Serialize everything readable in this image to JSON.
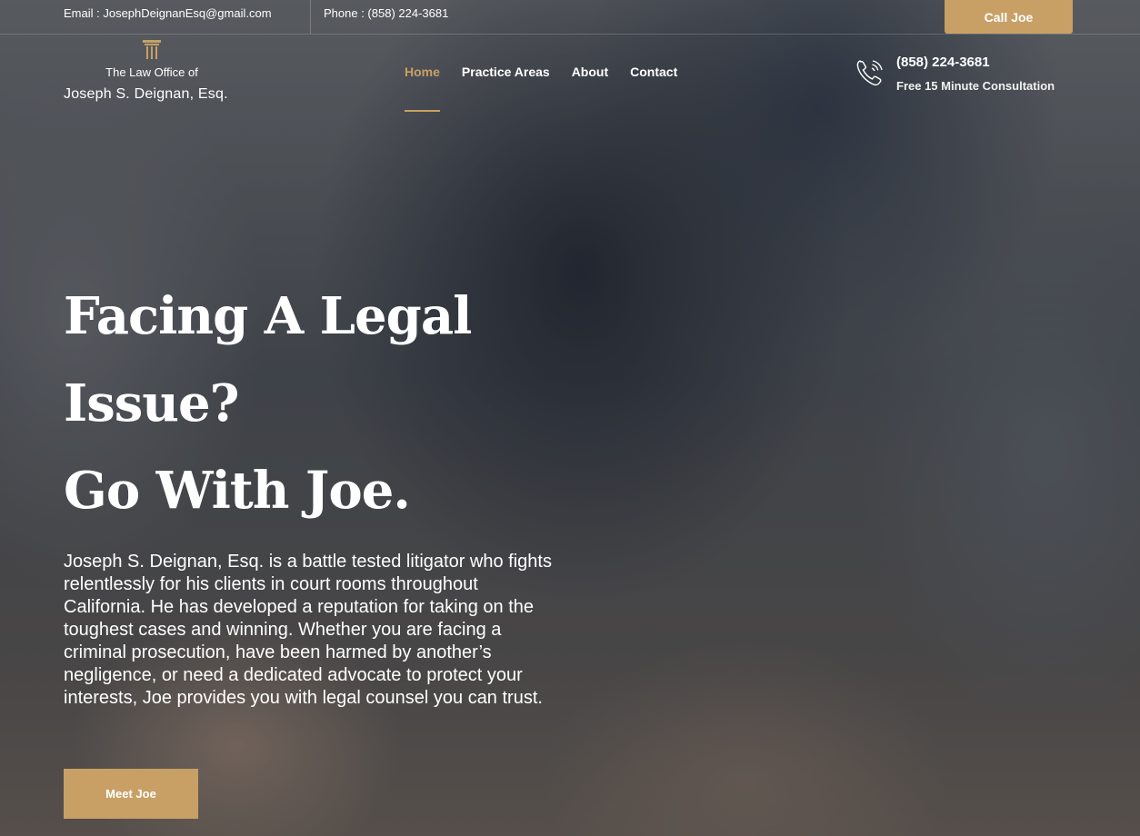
{
  "topbar": {
    "email": "Email : JosephDeignanEsq@gmail.com",
    "phone": "Phone : (858) 224-3681",
    "cta_label": "Call Joe"
  },
  "logo": {
    "icon": "pillar-icon",
    "line1": "The Law Office of",
    "line2": "Joseph S. Deignan, Esq."
  },
  "nav": {
    "items": [
      {
        "label": "Home",
        "active": true
      },
      {
        "label": "Practice Areas",
        "active": false
      },
      {
        "label": "About",
        "active": false
      },
      {
        "label": "Contact",
        "active": false
      }
    ]
  },
  "header_contact": {
    "icon": "phone-icon",
    "phone": "(858) 224-3681",
    "subtitle": "Free 15 Minute Consultation"
  },
  "hero": {
    "headline_line1": "Facing A Legal",
    "headline_line2": "Issue?",
    "headline_line3": "Go With Joe.",
    "paragraph": "Joseph S. Deignan, Esq. is a battle tested litigator who fights relentlessly for his clients in court rooms throughout California. He has developed a reputation for taking on the toughest cases and winning. Whether you are facing a criminal prosecution, have been harmed by another’s negligence, or need a dedicated advocate to protect your interests, Joe provides you with legal counsel you can trust.",
    "cta_label": "Meet Joe"
  },
  "colors": {
    "accent": "#c8a066",
    "text": "#ffffff"
  }
}
